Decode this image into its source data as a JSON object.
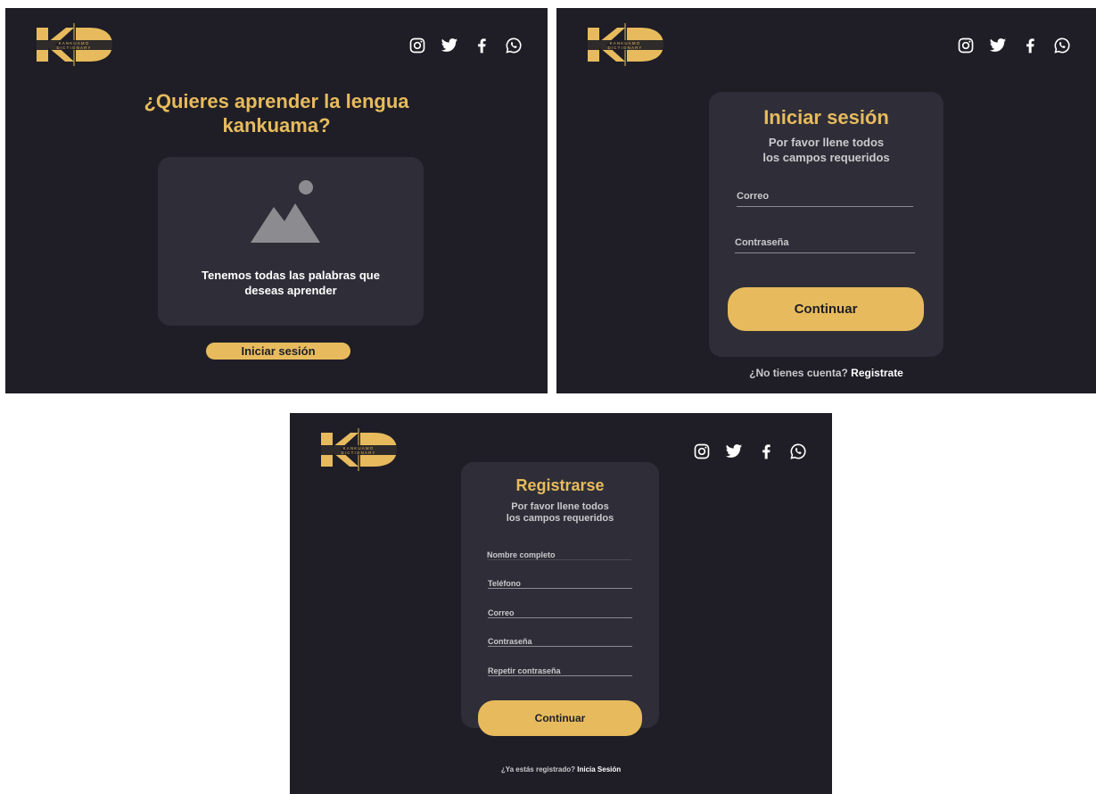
{
  "brand": {
    "logo_letters": "K D",
    "logo_text_top": "KANKUAMO",
    "logo_text_bottom": "DICTIONARY",
    "accent_color": "#e7bb5d",
    "background_color": "#1f1e26",
    "card_color": "#2f2e38"
  },
  "social_icons": [
    "instagram-icon",
    "twitter-icon",
    "facebook-icon",
    "whatsapp-icon"
  ],
  "home": {
    "title_line1": "¿Quieres aprender la lengua",
    "title_line2": "kankuama?",
    "card_icon": "image-placeholder-icon",
    "card_text_line1": "Tenemos todas las palabras que",
    "card_text_line2": "deseas aprender",
    "login_button": "Iniciar sesión"
  },
  "login": {
    "title": "Iniciar sesión",
    "subtitle_line1": "Por favor llene todos",
    "subtitle_line2": "los campos requeridos",
    "fields": [
      {
        "placeholder": "Correo",
        "value": ""
      },
      {
        "placeholder": "Contraseña",
        "value": ""
      }
    ],
    "continue_button": "Continuar",
    "footer_text": "¿No tienes cuenta?",
    "footer_link": "Registrate"
  },
  "register": {
    "title": "Registrarse",
    "subtitle_line1": "Por favor llene todos",
    "subtitle_line2": "los campos requeridos",
    "fields": [
      {
        "placeholder": "Nombre completo",
        "value": ""
      },
      {
        "placeholder": "Teléfono",
        "value": ""
      },
      {
        "placeholder": "Correo",
        "value": ""
      },
      {
        "placeholder": "Contraseña",
        "value": ""
      },
      {
        "placeholder": "Repetir contraseña",
        "value": ""
      }
    ],
    "continue_button": "Continuar",
    "footer_text": "¿Ya estás registrado?",
    "footer_link": "Inicia Sesión"
  }
}
